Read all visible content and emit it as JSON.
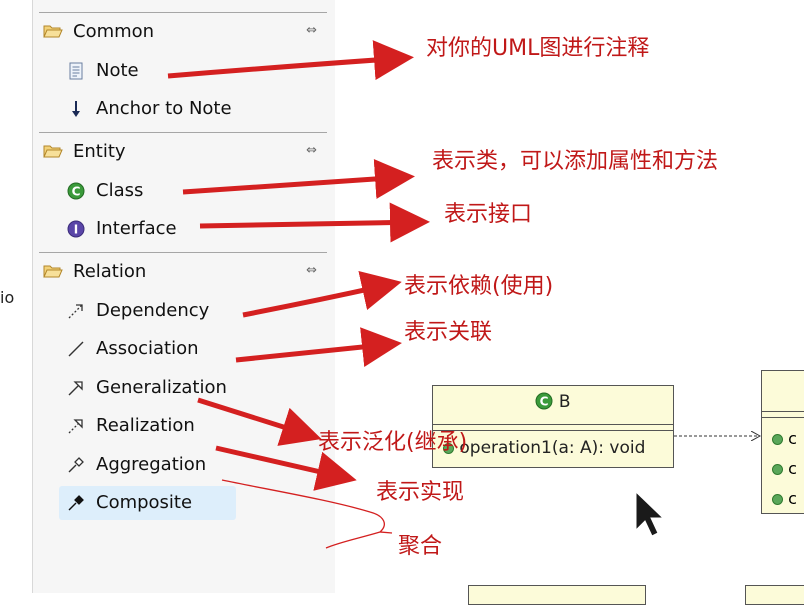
{
  "left_strip_text": "io",
  "palette": {
    "drawers": [
      {
        "title": "Common",
        "pin_icon": "pin-icon",
        "items": [
          {
            "label": "Note",
            "icon": "note-icon"
          },
          {
            "label": "Anchor to Note",
            "icon": "anchor-arrow-icon"
          }
        ]
      },
      {
        "title": "Entity",
        "pin_icon": "pin-icon",
        "items": [
          {
            "label": "Class",
            "icon": "class-icon"
          },
          {
            "label": "Interface",
            "icon": "interface-icon"
          }
        ]
      },
      {
        "title": "Relation",
        "pin_icon": "pin-icon",
        "items": [
          {
            "label": "Dependency",
            "icon": "dependency-icon"
          },
          {
            "label": "Association",
            "icon": "association-icon"
          },
          {
            "label": "Generalization",
            "icon": "generalization-icon"
          },
          {
            "label": "Realization",
            "icon": "realization-icon"
          },
          {
            "label": "Aggregation",
            "icon": "aggregation-icon"
          },
          {
            "label": "Composite",
            "icon": "composite-icon",
            "selected": true
          }
        ]
      }
    ]
  },
  "canvas": {
    "class_b": {
      "name": "B",
      "operation": "operation1(a: A): void"
    }
  },
  "annotations": {
    "note": "对你的UML图进行注释",
    "class": "表示类，可以添加属性和方法",
    "interface": "表示接口",
    "dependency": "表示依赖(使用)",
    "association": "表示关联",
    "generalization": "表示泛化(继承)",
    "realization": "表示实现",
    "aggregation": "聚合"
  },
  "colors": {
    "annotation": "#c01818",
    "class_fill": "#fcfbd9",
    "selection": "#ddeefb"
  }
}
